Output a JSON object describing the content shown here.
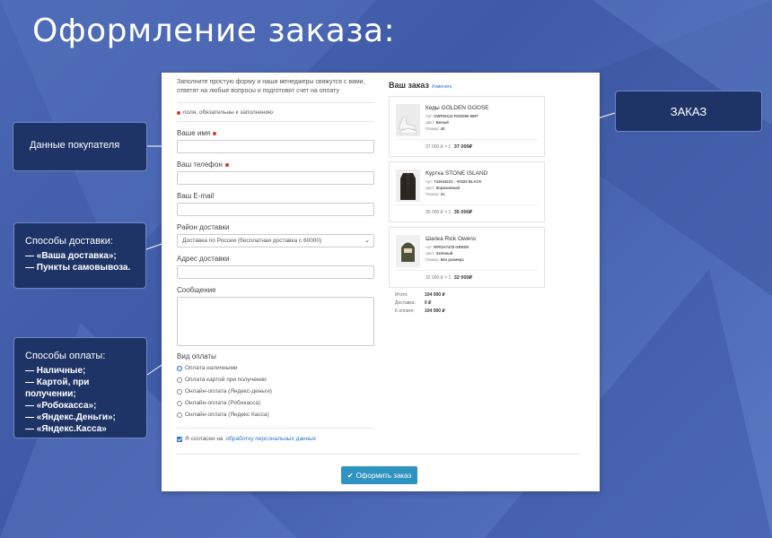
{
  "slide_title": "Оформление заказа:",
  "form": {
    "intro": "Заполните простую форму и наши менеджеры свяжутся с вами, ответят на любые вопросы и подготовят счет на оплату",
    "required_note": "поля, обязательны к заполнению",
    "name_label": "Ваше имя",
    "phone_label": "Ваш телефон",
    "email_label": "Ваш E-mail",
    "delivery_region_label": "Район доставки",
    "delivery_region_value": "Доставка по России (бесплатная доставка с 60000)",
    "address_label": "Адрес доставки",
    "message_label": "Сообщение",
    "payment_label": "Вид оплаты",
    "payment_options": [
      "Оплата наличными",
      "Оплата картой при получении",
      "Онлайн-оплата (Яндекс-деньги)",
      "Онлайн-оплата (Робокасса)",
      "Онлайн-оплата (Яндекс Касса)"
    ],
    "selected_payment": 0,
    "agree_text": "Я согласен на",
    "agree_link": "обработку персональных данных",
    "submit_label": "Оформить заказ"
  },
  "order": {
    "title": "Ваш заказ",
    "change_link": "Изменить",
    "items": [
      {
        "name": "Кеды GOLDEN GOOSE",
        "art_label": "Арт:",
        "art": "GWF00113 F002065 WHT",
        "color_label": "Цвет:",
        "color": "Белый",
        "size_label": "Размер:",
        "size": "40",
        "price": "37 000 ₽ × 1",
        "total": "37 000₽"
      },
      {
        "name": "Куртка STONE ISLAND",
        "art_label": "Арт:",
        "art": "7415442X1 - V0020 BLACK",
        "color_label": "Цвет:",
        "color": "Коричневый",
        "size_label": "Размер:",
        "size": "XL",
        "price": "35 000 ₽ × 1",
        "total": "35 000₽"
      },
      {
        "name": "Шапка Rick Owens",
        "art_label": "Арт:",
        "art": "RP02A7478 GREEN",
        "color_label": "Цвет:",
        "color": "Зеленый",
        "size_label": "Размер:",
        "size": "Без размера",
        "price": "32 000 ₽ × 1",
        "total": "32 000₽"
      }
    ],
    "totals": [
      {
        "label": "Итого:",
        "value": "104 000 ₽"
      },
      {
        "label": "Доставка:",
        "value": "0 ₽"
      },
      {
        "label": "К оплате:",
        "value": "104 000 ₽"
      }
    ]
  },
  "callouts": {
    "buyer": "Данные покупателя",
    "delivery_title": "Способы доставки:",
    "delivery_items": [
      "— «Ваша доставка»;",
      "— Пункты самовывоза."
    ],
    "payment_title": "Способы оплаты:",
    "payment_items": [
      "— Наличные;",
      "— Картой, при получении;",
      "— «Робокасса»;",
      "— «Яндекс.Деньги»;",
      "— «Яндекс.Касса»"
    ],
    "order": "ЗАКАЗ"
  },
  "colors": {
    "accent": "#2a73c9",
    "button": "#2f93c0",
    "callout_bg": "#1f3466",
    "required": "#d9342b",
    "background": "#4a67b3"
  }
}
